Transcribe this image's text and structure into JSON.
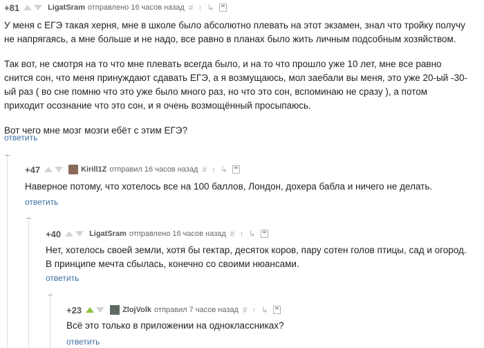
{
  "comments": [
    {
      "rating": "+81",
      "username": "LigatSram",
      "sent_label": "отправлено 16 часов назад",
      "paragraphs": [
        "У меня с ЕГЭ такая херня, мне в школе было абсолютно плевать на этот экзамен, знал что тройку получу не напрягаясь, а мне больше и не надо, все равно в планах было жить личным подсобным хозяйством.",
        "Так вот, не смотря на то что мне плевать всегда было, и на то что прошло уже 10 лет, мне все равно снится сон, что  меня принуждают сдавать ЕГЭ, а я  возмущаюсь, мол заебали вы меня, это уже 20-ый -30-ый раз ( во сне помню что это уже было много раз, но что это сон, вспоминаю не сразу ), а потом приходит осознание что это сон, и я очень возмощённый просыпаюсь.",
        "Вот чего мне мозг мозги ебёт с этим ЕГЭ?"
      ],
      "reply_label": "ответить"
    },
    {
      "rating": "+47",
      "username": "Kirill1Z",
      "sent_label": "отправил 16 часов назад",
      "paragraphs": [
        "Наверное потому, что хотелось все на 100 баллов, Лондон, дохера бабла и ничего не делать."
      ],
      "reply_label": "ответить"
    },
    {
      "rating": "+40",
      "username": "LigatSram",
      "sent_label": "отправлено 16 часов назад",
      "paragraphs": [
        "Нет, хотелось своей земли, хотя бы гектар, десяток коров, пару сотен голов птицы, сад и огород. В принципе мечта сбылась, конечно со своими нюансами."
      ],
      "reply_label": "ответить"
    },
    {
      "rating": "+23",
      "username": "ZlojVolk",
      "sent_label": "отправил 7 часов назад",
      "paragraphs": [
        "Всё это только в приложении на одноклассниках?"
      ],
      "reply_label": "ответить"
    }
  ],
  "tool_icons": [
    "hash-icon",
    "arrow-up-icon",
    "parent-link-icon",
    "save-icon"
  ],
  "colors": {
    "link": "#3b6ea5",
    "vote_up_active": "#8ac23d",
    "vote_idle": "#cfd4d8",
    "thread_line": "#dedede"
  }
}
